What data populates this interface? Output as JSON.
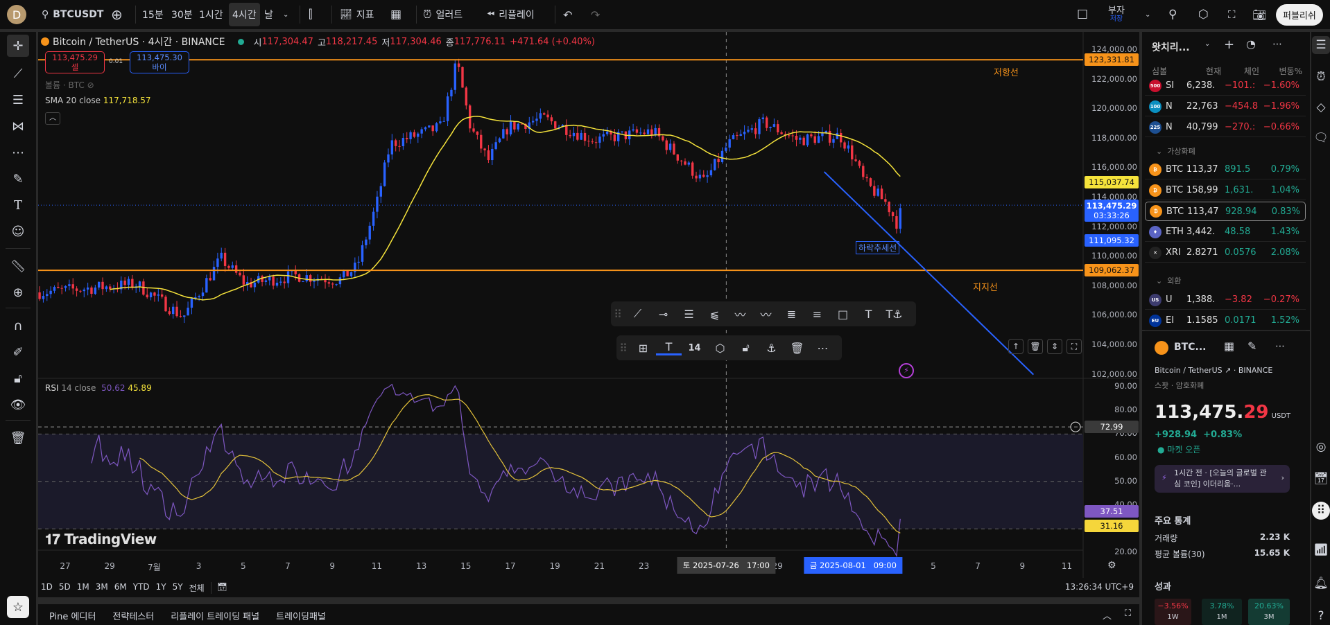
{
  "topbar": {
    "avatar": "D",
    "symbol": "BTCUSDT",
    "intervals": [
      "15분",
      "30분",
      "1시간",
      "4시간",
      "날"
    ],
    "selected_interval": "4시간",
    "indicators_label": "지표",
    "alert_label": "얼러트",
    "replay_label": "리플레이",
    "layout_name": "부자",
    "layout_save": "저장",
    "publish_label": "퍼블리쉬"
  },
  "legend": {
    "title": "Bitcoin / TetherUS · 4시간 · BINANCE",
    "o_label": "시",
    "o": "117,304.47",
    "h_label": "고",
    "h": "118,217.45",
    "l_label": "저",
    "l": "117,304.46",
    "c_label": "종",
    "c": "117,776.11",
    "change": "+471.64 (+0.40%)",
    "sell_price": "113,475.29",
    "sell_label": "셀",
    "spread": "0.01",
    "buy_price": "113,475.30",
    "buy_label": "바이",
    "volume_label": "볼륨 · BTC",
    "sma_label": "SMA 20 close",
    "sma_value": "117,718.57",
    "rsi_label": "RSI",
    "rsi_params": "14 close",
    "rsi_value": "50.62",
    "rsi_ma_value": "45.89"
  },
  "drawings": {
    "resistance_label": "저항선",
    "resistance_price": 123331.81,
    "support_label": "지지선",
    "support_price": 109062.37,
    "trendline_label": "하락추세선",
    "trendline": [
      [
        34.1,
        115740
      ],
      [
        43.5,
        102000
      ]
    ],
    "rsi_line": 72.99
  },
  "colors": {
    "up": "#2962ff",
    "down": "#f23645",
    "sma": "#f5e33b",
    "rsi": "#7e57c2",
    "rsi_ma": "#e4c23a",
    "level": "#f7931a",
    "trend": "#2962ff"
  },
  "chart_data": {
    "type": "candlestick",
    "x_unit": "days since 2025-06-27",
    "anchors": [
      [
        -1.15,
        107570
      ],
      [
        3.2,
        108130
      ],
      [
        5.3,
        105900
      ],
      [
        7.0,
        109870
      ],
      [
        8.1,
        108130
      ],
      [
        10.4,
        108720
      ],
      [
        12.3,
        108400
      ],
      [
        13.1,
        109300
      ],
      [
        14.0,
        113600
      ],
      [
        14.6,
        117620
      ],
      [
        16.9,
        118780
      ],
      [
        17.6,
        123200
      ],
      [
        18.2,
        118780
      ],
      [
        19.0,
        116490
      ],
      [
        19.9,
        118780
      ],
      [
        21.5,
        119350
      ],
      [
        23.7,
        117900
      ],
      [
        26.4,
        118480
      ],
      [
        28.7,
        115040
      ],
      [
        29.8,
        117620
      ],
      [
        31.4,
        119070
      ],
      [
        32.9,
        117900
      ],
      [
        34.8,
        118200
      ],
      [
        35.4,
        116770
      ],
      [
        35.9,
        115040
      ],
      [
        36.9,
        113600
      ],
      [
        37.4,
        112170
      ],
      [
        37.6,
        113475
      ]
    ],
    "price_ticks": [
      "124,000.00",
      "122,000.00",
      "120,000.00",
      "118,000.00",
      "116,000.00",
      "114,000.00",
      "112,000.00",
      "110,000.00",
      "108,000.00",
      "106,000.00",
      "104,000.00",
      "102,000.00"
    ],
    "price_tags": [
      {
        "value": "123,331.81",
        "kind": "level"
      },
      {
        "value": "115,037.74",
        "kind": "sma"
      },
      {
        "value": "113,475.29",
        "sub": "03:33:26",
        "kind": "last"
      },
      {
        "value": "111,095.32",
        "kind": "cross"
      },
      {
        "value": "109,062.37",
        "kind": "level"
      }
    ],
    "rsi_ticks": [
      "90.00",
      "80.00",
      "70.00",
      "60.00",
      "50.00",
      "40.00",
      "30.00",
      "20.00"
    ],
    "rsi_tags": [
      {
        "value": "72.99",
        "kind": "line"
      },
      {
        "value": "37.51",
        "kind": "rsi"
      },
      {
        "value": "31.16",
        "kind": "ma"
      }
    ],
    "time_ticks": [
      [
        0,
        "27"
      ],
      [
        2,
        "29"
      ],
      [
        4,
        "7월"
      ],
      [
        6,
        "3"
      ],
      [
        8,
        "5"
      ],
      [
        10,
        "7"
      ],
      [
        12,
        "9"
      ],
      [
        14,
        "11"
      ],
      [
        16,
        "13"
      ],
      [
        18,
        "15"
      ],
      [
        20,
        "17"
      ],
      [
        22,
        "19"
      ],
      [
        24,
        "21"
      ],
      [
        26,
        "23"
      ],
      [
        32,
        "29"
      ],
      [
        39,
        "5"
      ],
      [
        41,
        "7"
      ],
      [
        43,
        "9"
      ],
      [
        45,
        "11"
      ]
    ],
    "crosshair": {
      "day": 29.7,
      "label": "토 2025-07-26   17:00"
    },
    "selected_time": {
      "day": 35.4,
      "label": "금 2025-08-01   09:00"
    }
  },
  "drawing_toolbar": {
    "font_size": "14"
  },
  "rangebar": {
    "ranges": [
      "1D",
      "5D",
      "1M",
      "3M",
      "6M",
      "YTD",
      "1Y",
      "5Y",
      "전체"
    ],
    "clock": "13:26:34 UTC+9"
  },
  "bottompanel": {
    "tabs": [
      "Pine 에디터",
      "전략테스터",
      "리플레이 트레이딩 패널",
      "트레이딩패널"
    ]
  },
  "watchlist": {
    "title": "왓치리...",
    "columns": [
      "심볼",
      "현재",
      "체인",
      "변동%"
    ],
    "rows1": [
      {
        "icon": "500",
        "color": "#c8102e",
        "sym": "SI",
        "last": "6,238.",
        "chg": "−101.:",
        "pct": "−1.60%",
        "dir": "red"
      },
      {
        "icon": "100",
        "color": "#0a8fc0",
        "sym": "N",
        "last": "22,763",
        "chg": "−454.8",
        "pct": "−1.96%",
        "dir": "red"
      },
      {
        "icon": "225",
        "color": "#1d4f91",
        "sym": "N",
        "last": "40,799",
        "chg": "−270.:",
        "pct": "−0.66%",
        "dir": "red"
      }
    ],
    "section_crypto": "가상화폐",
    "rows2": [
      {
        "icon": "₿",
        "color": "#f7931a",
        "sym": "BTC",
        "last": "113,37",
        "chg": "891.5",
        "pct": "0.79%",
        "dir": "green",
        "lastdir": ""
      },
      {
        "icon": "₿",
        "color": "#f7931a",
        "sym": "BTC",
        "last": "158,99",
        "chg": "1,631.",
        "pct": "1.04%",
        "dir": "green",
        "lastdir": ""
      },
      {
        "icon": "₿",
        "color": "#f7931a",
        "sym": "BTC",
        "last": "113,47",
        "chg": "928.94",
        "pct": "0.83%",
        "dir": "green",
        "lastdir": ""
      },
      {
        "icon": "♦",
        "color": "#5b64c4",
        "sym": "ETH",
        "last": "3,442.",
        "chg": "48.58",
        "pct": "1.43%",
        "dir": "green",
        "lastdir": "red"
      },
      {
        "icon": "✕",
        "color": "#222",
        "sym": "XRI",
        "last": "2.8271",
        "chg": "0.0576",
        "pct": "2.08%",
        "dir": "green",
        "lastdir": "red"
      }
    ],
    "section_fx": "외환",
    "rows3": [
      {
        "icon": "US",
        "color": "#3c3b6e",
        "sym": "U",
        "last": "1,388.",
        "chg": "−3.82",
        "pct": "−0.27%",
        "dir": "red"
      },
      {
        "icon": "EU",
        "color": "#003399",
        "sym": "EI",
        "last": "1.1585",
        "chg": "0.0171",
        "pct": "1.52%",
        "dir": "green"
      }
    ]
  },
  "detail": {
    "symbol": "BTC...",
    "name": "Bitcoin / TetherUS",
    "exchange": "BINANCE",
    "type": "스팟 · 암호화폐",
    "price_main": "113,475.",
    "price_dec": "29",
    "currency": "USDT",
    "change": "+928.94",
    "change_pct": "+0.83%",
    "market_status": "마켓 오픈",
    "news": "1시간 전 · [오늘의 글로벌 관심 코인] 이더리움·...",
    "stats_title": "주요 통계",
    "volume_label": "거래량",
    "volume": "2.23 K",
    "avg_volume_label": "평균 볼륨(30)",
    "avg_volume": "15.65 K",
    "perf_title": "성과",
    "perf": [
      {
        "value": "−3.56%",
        "period": "1W",
        "dir": "red"
      },
      {
        "value": "3.78%",
        "period": "1M",
        "dir": "green"
      },
      {
        "value": "20.63%",
        "period": "3M",
        "dir": "green"
      }
    ]
  }
}
